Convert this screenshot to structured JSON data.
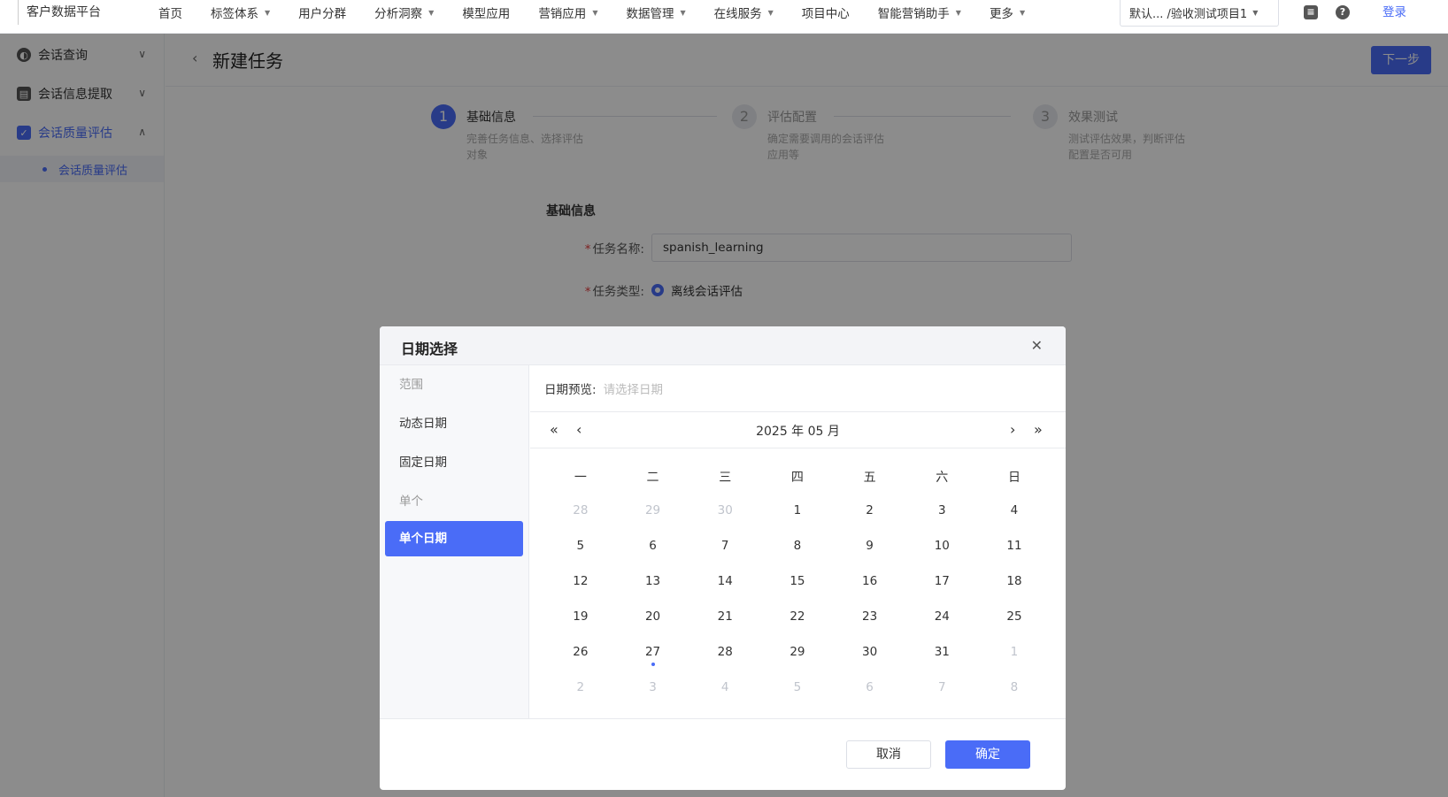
{
  "topnav": {
    "brand": "客户数据平台",
    "items": [
      {
        "label": "首页",
        "caret": false
      },
      {
        "label": "标签体系",
        "caret": true
      },
      {
        "label": "用户分群",
        "caret": false
      },
      {
        "label": "分析洞察",
        "caret": true
      },
      {
        "label": "模型应用",
        "caret": false
      },
      {
        "label": "营销应用",
        "caret": true
      },
      {
        "label": "数据管理",
        "caret": true
      },
      {
        "label": "在线服务",
        "caret": true
      },
      {
        "label": "项目中心",
        "caret": false
      },
      {
        "label": "智能营销助手",
        "caret": true
      },
      {
        "label": "更多",
        "caret": true
      }
    ],
    "project": "默认... /验收测试项目1",
    "login": "登录"
  },
  "sidebar": {
    "groups": [
      {
        "label": "会话查询",
        "icon": "chat-icon"
      },
      {
        "label": "会话信息提取",
        "icon": "extract-icon"
      },
      {
        "label": "会话质量评估",
        "icon": "checkbox-icon"
      }
    ],
    "sub": "会话质量评估"
  },
  "page": {
    "title": "新建任务",
    "next": "下一步",
    "steps": [
      {
        "num": "1",
        "title": "基础信息",
        "desc": "完善任务信息、选择评估对象"
      },
      {
        "num": "2",
        "title": "评估配置",
        "desc": "确定需要调用的会话评估应用等"
      },
      {
        "num": "3",
        "title": "效果测试",
        "desc": "测试评估效果，判断评估配置是否可用"
      }
    ],
    "section": "基础信息",
    "name_label": "任务名称:",
    "name_value": "spanish_learning",
    "type_label": "任务类型:",
    "type_value": "离线会话评估"
  },
  "modal": {
    "title": "日期选择",
    "left": [
      {
        "label": "范围",
        "kind": "group"
      },
      {
        "label": "动态日期",
        "kind": "item"
      },
      {
        "label": "固定日期",
        "kind": "item"
      },
      {
        "label": "单个",
        "kind": "group"
      },
      {
        "label": "单个日期",
        "kind": "selected"
      }
    ],
    "preview_label": "日期预览:",
    "preview_placeholder": "请选择日期",
    "calendar_title": "2025 年 05 月",
    "weekdays": [
      "一",
      "二",
      "三",
      "四",
      "五",
      "六",
      "日"
    ],
    "weeks": [
      [
        "28",
        "29",
        "30",
        "1",
        "2",
        "3",
        "4"
      ],
      [
        "5",
        "6",
        "7",
        "8",
        "9",
        "10",
        "11"
      ],
      [
        "12",
        "13",
        "14",
        "15",
        "16",
        "17",
        "18"
      ],
      [
        "19",
        "20",
        "21",
        "22",
        "23",
        "24",
        "25"
      ],
      [
        "26",
        "27",
        "28",
        "29",
        "30",
        "31",
        "1"
      ],
      [
        "2",
        "3",
        "4",
        "5",
        "6",
        "7",
        "8"
      ]
    ],
    "today": "27",
    "cancel": "取消",
    "ok": "确定"
  }
}
